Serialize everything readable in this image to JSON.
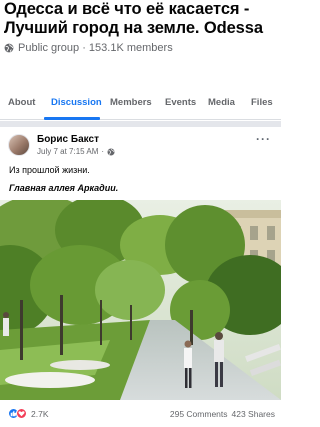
{
  "group": {
    "title": "Одесса и всё что её касается - Лучший город на земле. Odessa",
    "meta": "Public group · 153.1K members"
  },
  "tabs": [
    {
      "label": "About"
    },
    {
      "label": "Discussion",
      "active": true
    },
    {
      "label": "Members"
    },
    {
      "label": "Events"
    },
    {
      "label": "Media"
    },
    {
      "label": "Files"
    }
  ],
  "post": {
    "author": "Борис Бакст",
    "time": "July 7 at 7:15 AM",
    "text_line1": "Из прошлой жизни.",
    "text_line2": "Главная аллея Аркадии.",
    "more_icon": "more-dots-icon"
  },
  "footer": {
    "reaction_count": "2.7K",
    "comments": "295 Comments",
    "shares": "423 Shares",
    "reaction_icons": [
      "like-icon",
      "love-icon"
    ]
  },
  "colors": {
    "accent": "#1877f2",
    "secondary_text": "#65676b",
    "love": "#f33e58"
  }
}
